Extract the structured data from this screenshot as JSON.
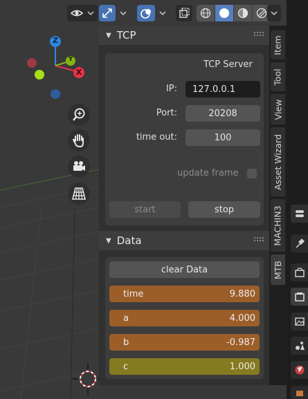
{
  "header": {
    "icons": [
      "eye-icon",
      "gizmo-icon",
      "overlay-icon",
      "xray-icon",
      "wireframe-shading-icon",
      "solid-shading-icon",
      "material-shading-icon",
      "rendered-shading-icon"
    ]
  },
  "tcp_panel": {
    "title": "TCP",
    "heading": "TCP Server",
    "ip_label": "IP:",
    "ip_value": "127.0.0.1",
    "port_label": "Port:",
    "port_value": "20208",
    "timeout_label": "time out:",
    "timeout_value": "100",
    "update_frame_label": "update frame",
    "update_frame_checked": false,
    "start_label": "start",
    "stop_label": "stop"
  },
  "data_panel": {
    "title": "Data",
    "clear_label": "clear Data",
    "rows": [
      {
        "name": "time",
        "value": "9.880",
        "color": "#9c5e28"
      },
      {
        "name": "a",
        "value": "4.000",
        "color": "#9c5e28"
      },
      {
        "name": "b",
        "value": "-0.987",
        "color": "#9c5e28"
      },
      {
        "name": "c",
        "value": "1.000",
        "color": "#857a1f"
      }
    ]
  },
  "tabs": {
    "item": "Item",
    "tool": "Tool",
    "view": "View",
    "asset_wizard": "Asset Wizard",
    "machin3": "MACHIN3",
    "mtb": "MTB",
    "active": "MTB"
  },
  "gizmo": {
    "z": "Z",
    "y": "Y",
    "x": "X"
  },
  "colors": {
    "accent": "#4772b3",
    "row_orange": "#9c5e28",
    "row_olive": "#857a1f",
    "axis_x": "#e8334a",
    "axis_y": "#82b514",
    "axis_z": "#2d88e0"
  }
}
